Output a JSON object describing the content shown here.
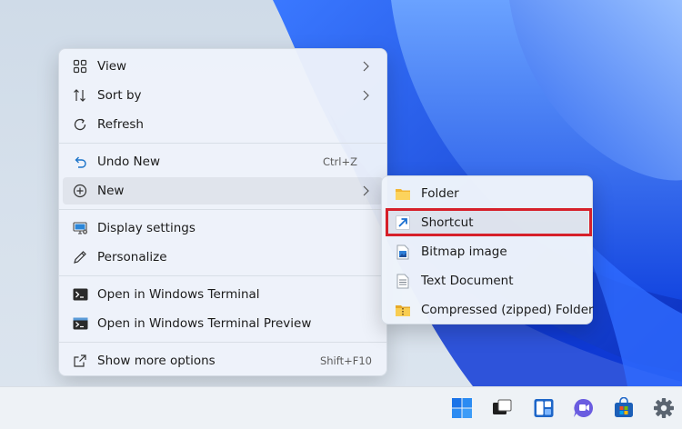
{
  "context_menu": {
    "items": [
      {
        "label": "View",
        "icon": "grid-view-icon",
        "has_submenu": true
      },
      {
        "label": "Sort by",
        "icon": "sort-icon",
        "has_submenu": true
      },
      {
        "label": "Refresh",
        "icon": "refresh-icon"
      },
      {
        "label": "Undo New",
        "icon": "undo-icon",
        "shortcut": "Ctrl+Z"
      },
      {
        "label": "New",
        "icon": "plus-circle-icon",
        "has_submenu": true
      },
      {
        "label": "Display settings",
        "icon": "display-icon"
      },
      {
        "label": "Personalize",
        "icon": "pen-icon"
      },
      {
        "label": "Open in Windows Terminal",
        "icon": "terminal-icon"
      },
      {
        "label": "Open in Windows Terminal Preview",
        "icon": "terminal-preview-icon"
      },
      {
        "label": "Show more options",
        "icon": "share-icon",
        "shortcut": "Shift+F10"
      }
    ]
  },
  "new_submenu": {
    "items": [
      {
        "label": "Folder",
        "icon": "folder-icon"
      },
      {
        "label": "Shortcut",
        "icon": "shortcut-arrow-icon",
        "highlighted": true
      },
      {
        "label": "Bitmap image",
        "icon": "bitmap-icon"
      },
      {
        "label": "Text Document",
        "icon": "text-document-icon"
      },
      {
        "label": "Compressed (zipped) Folder",
        "icon": "zip-folder-icon"
      }
    ]
  },
  "taskbar": {
    "icons": [
      "windows-start-icon",
      "task-view-icon",
      "widgets-icon",
      "teams-chat-icon",
      "microsoft-store-icon",
      "settings-gear-icon"
    ]
  },
  "colors": {
    "accent": "#0067c0",
    "highlight_border": "#d6202a",
    "wallpaper_blue": "#1f5be8"
  }
}
